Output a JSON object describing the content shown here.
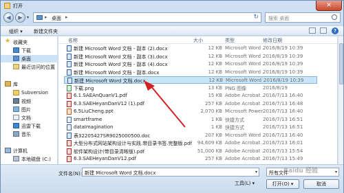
{
  "window": {
    "title": "打开",
    "close_glyph": "✕"
  },
  "nav": {
    "back_glyph": "◀",
    "forward_glyph": "▶",
    "dropdown_glyph": "▾",
    "address_sep": "▸",
    "address": "桌面",
    "address_sep2": "▸",
    "refresh_glyph": "↻",
    "search_placeholder": "搜索 桌面"
  },
  "toolbar": {
    "organize": "组织 ▾",
    "new_folder": "新建文件夹",
    "help_glyph": "?"
  },
  "sidebar": {
    "items": [
      {
        "label": "收藏夹",
        "icon": "star-icon",
        "selected": false
      },
      {
        "label": "下载",
        "icon": "download-folder-icon",
        "selected": false
      },
      {
        "label": "桌面",
        "icon": "desktop-icon",
        "selected": true
      },
      {
        "label": "最近访问的位置",
        "icon": "recent-places-icon",
        "selected": false
      },
      {
        "label": "库",
        "icon": "libraries-icon",
        "selected": false
      },
      {
        "label": "Subversion",
        "icon": "folder-icon",
        "selected": false
      },
      {
        "label": "视频",
        "icon": "video-icon",
        "selected": false
      },
      {
        "label": "图片",
        "icon": "pictures-icon",
        "selected": false
      },
      {
        "label": "文档",
        "icon": "documents-icon",
        "selected": false
      },
      {
        "label": "迅雷下载",
        "icon": "thunder-download-icon",
        "selected": false
      },
      {
        "label": "音乐",
        "icon": "music-icon",
        "selected": false
      },
      {
        "label": "计算机",
        "icon": "computer-icon",
        "selected": false
      },
      {
        "label": "本地磁盘 (C:)",
        "icon": "drive-icon",
        "selected": false
      }
    ]
  },
  "columns": {
    "name": "名称",
    "size": "大小",
    "type": "类型",
    "date": "修改日期"
  },
  "files": [
    {
      "name": "新建 Microsoft Word 文档 - 副本 (2).docx",
      "size": "12 KB",
      "type": "Microsoft Word ...",
      "date": "2016/8/19 10:39",
      "icon": "word-doc-icon"
    },
    {
      "name": "新建 Microsoft Word 文档 - 副本 (3).docx",
      "size": "12 KB",
      "type": "Microsoft Word ...",
      "date": "2016/8/19 10:39",
      "icon": "word-doc-icon"
    },
    {
      "name": "新建 Microsoft Word 文档 - 副本 (4).docx",
      "size": "12 KB",
      "type": "Microsoft Word ...",
      "date": "2016/8/19 10:39",
      "icon": "word-doc-icon"
    },
    {
      "name": "新建 Microsoft Word 文档 - 副本.docx",
      "size": "12 KB",
      "type": "Microsoft Word ...",
      "date": "2016/8/19 10:39",
      "icon": "word-doc-icon"
    },
    {
      "name": "新建 Microsoft Word 文档.docx",
      "size": "12 KB",
      "type": "Microsoft Word ...",
      "date": "2016/8/19 10:39",
      "icon": "word-doc-icon"
    },
    {
      "name": "下载.png",
      "size": "13 KB",
      "type": "PNG 图像",
      "date": "2016/8/19",
      "icon": "image-icon"
    },
    {
      "name": "6.1.SAEAnQuanV1.pdf",
      "size": "15 KB",
      "type": "Adobe Acrobat ...",
      "date": "2016/7/13 16:40",
      "icon": "pdf-icon"
    },
    {
      "name": "6.3.SAEHeyanDanV12 (1).pdf",
      "size": "257 KB",
      "type": "Adobe Acrobat ...",
      "date": "2016/7/13 16:48",
      "icon": "pdf-icon"
    },
    {
      "name": "6.5LiuCheng.ppt",
      "size": "2,070 KB",
      "type": "Microsoft Power...",
      "date": "2016/7/13 16:40",
      "icon": "ppt-icon"
    },
    {
      "name": "smartframe",
      "size": "1 KB",
      "type": "快捷方式",
      "date": "2016/7/13 16:51",
      "icon": "shortcut-icon"
    },
    {
      "name": "dataImagination",
      "size": "1 KB",
      "type": "快捷方式",
      "date": "2016/7/13 16:51",
      "icon": "shortcut-icon"
    },
    {
      "name": "表32205427SR9025000500.doc",
      "size": "207 KB",
      "type": "Microsoft Word ...",
      "date": "2016/7/13 16:40",
      "icon": "word-doc-icon"
    },
    {
      "name": "大型分布式网站架构设计与实践.带目录书签.完整版.pdf",
      "size": "94,609 KB",
      "type": "Adobe Acrobat ...",
      "date": "2016/7/13 16:01",
      "icon": "pdf-icon"
    },
    {
      "name": "软件架构设计(带目录清晰版).pdf",
      "size": "51,000 KB",
      "type": "Adobe Acrobat ...",
      "date": "2016/7/13 15:54",
      "icon": "pdf-icon"
    },
    {
      "name": "6.3.SAEHeyanDanV12.pdf",
      "size": "257 KB",
      "type": "Adobe Acrobat ...",
      "date": "2016/7/13 15:49",
      "icon": "pdf-icon"
    }
  ],
  "bottom": {
    "filename_label": "文件名(N):",
    "filename_value": "新建 Microsoft Word 文档.docx",
    "dropdown_glyph": "▾",
    "filetype_value": "所有文件",
    "tools_label": "工具(L) ▾",
    "open_label": "打开(O) ▾",
    "cancel_label": "取消"
  },
  "watermark": "Baidu 经验",
  "colors": {
    "accent": "#3b6fb0",
    "selection": "#cbe5f8",
    "arrow": "#d32020"
  }
}
